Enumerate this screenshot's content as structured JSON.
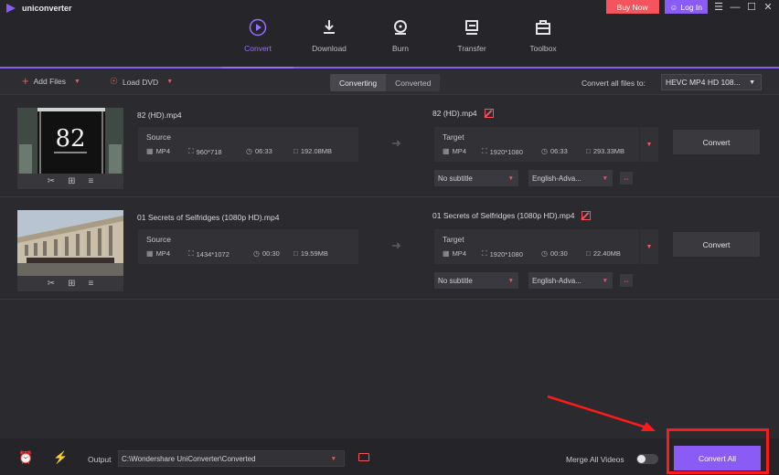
{
  "app": {
    "name": "uniconverter"
  },
  "header": {
    "buy_now": "Buy Now",
    "login": "Log In"
  },
  "nav": [
    {
      "label": "Convert",
      "active": true
    },
    {
      "label": "Download"
    },
    {
      "label": "Burn"
    },
    {
      "label": "Transfer"
    },
    {
      "label": "Toolbox"
    }
  ],
  "toolbar": {
    "add_files": "Add Files",
    "load_dvd": "Load DVD",
    "tab_converting": "Converting",
    "tab_converted": "Converted",
    "convert_all_label": "Convert all files to:",
    "format_value": "HEVC MP4 HD 108..."
  },
  "files": [
    {
      "name": "82 (HD).mp4",
      "source_label": "Source",
      "src_format": "MP4",
      "src_resolution": "960*718",
      "src_duration": "06:33",
      "src_size": "192.08MB",
      "target_name": "82 (HD).mp4",
      "target_label": "Target",
      "tgt_format": "MP4",
      "tgt_resolution": "1920*1080",
      "tgt_duration": "06:33",
      "tgt_size": "293.33MB",
      "subtitle": "No subtitle",
      "audio": "English-Adva...",
      "convert_label": "Convert",
      "thumb_text": "82"
    },
    {
      "name": "01 Secrets of Selfridges (1080p HD).mp4",
      "source_label": "Source",
      "src_format": "MP4",
      "src_resolution": "1434*1072",
      "src_duration": "00:30",
      "src_size": "19.59MB",
      "target_name": "01 Secrets of Selfridges (1080p HD).mp4",
      "target_label": "Target",
      "tgt_format": "MP4",
      "tgt_resolution": "1920*1080",
      "tgt_duration": "00:30",
      "tgt_size": "22.40MB",
      "subtitle": "No subtitle",
      "audio": "English-Adva...",
      "convert_label": "Convert"
    }
  ],
  "bottom": {
    "output_label": "Output",
    "output_path": "C:\\Wondershare UniConverter\\Converted",
    "merge_label": "Merge All Videos",
    "merge_on": false,
    "convert_all": "Convert All"
  },
  "colors": {
    "accent": "#8a5cf5",
    "danger": "#f4555d",
    "annotation": "#ff1a1a"
  }
}
